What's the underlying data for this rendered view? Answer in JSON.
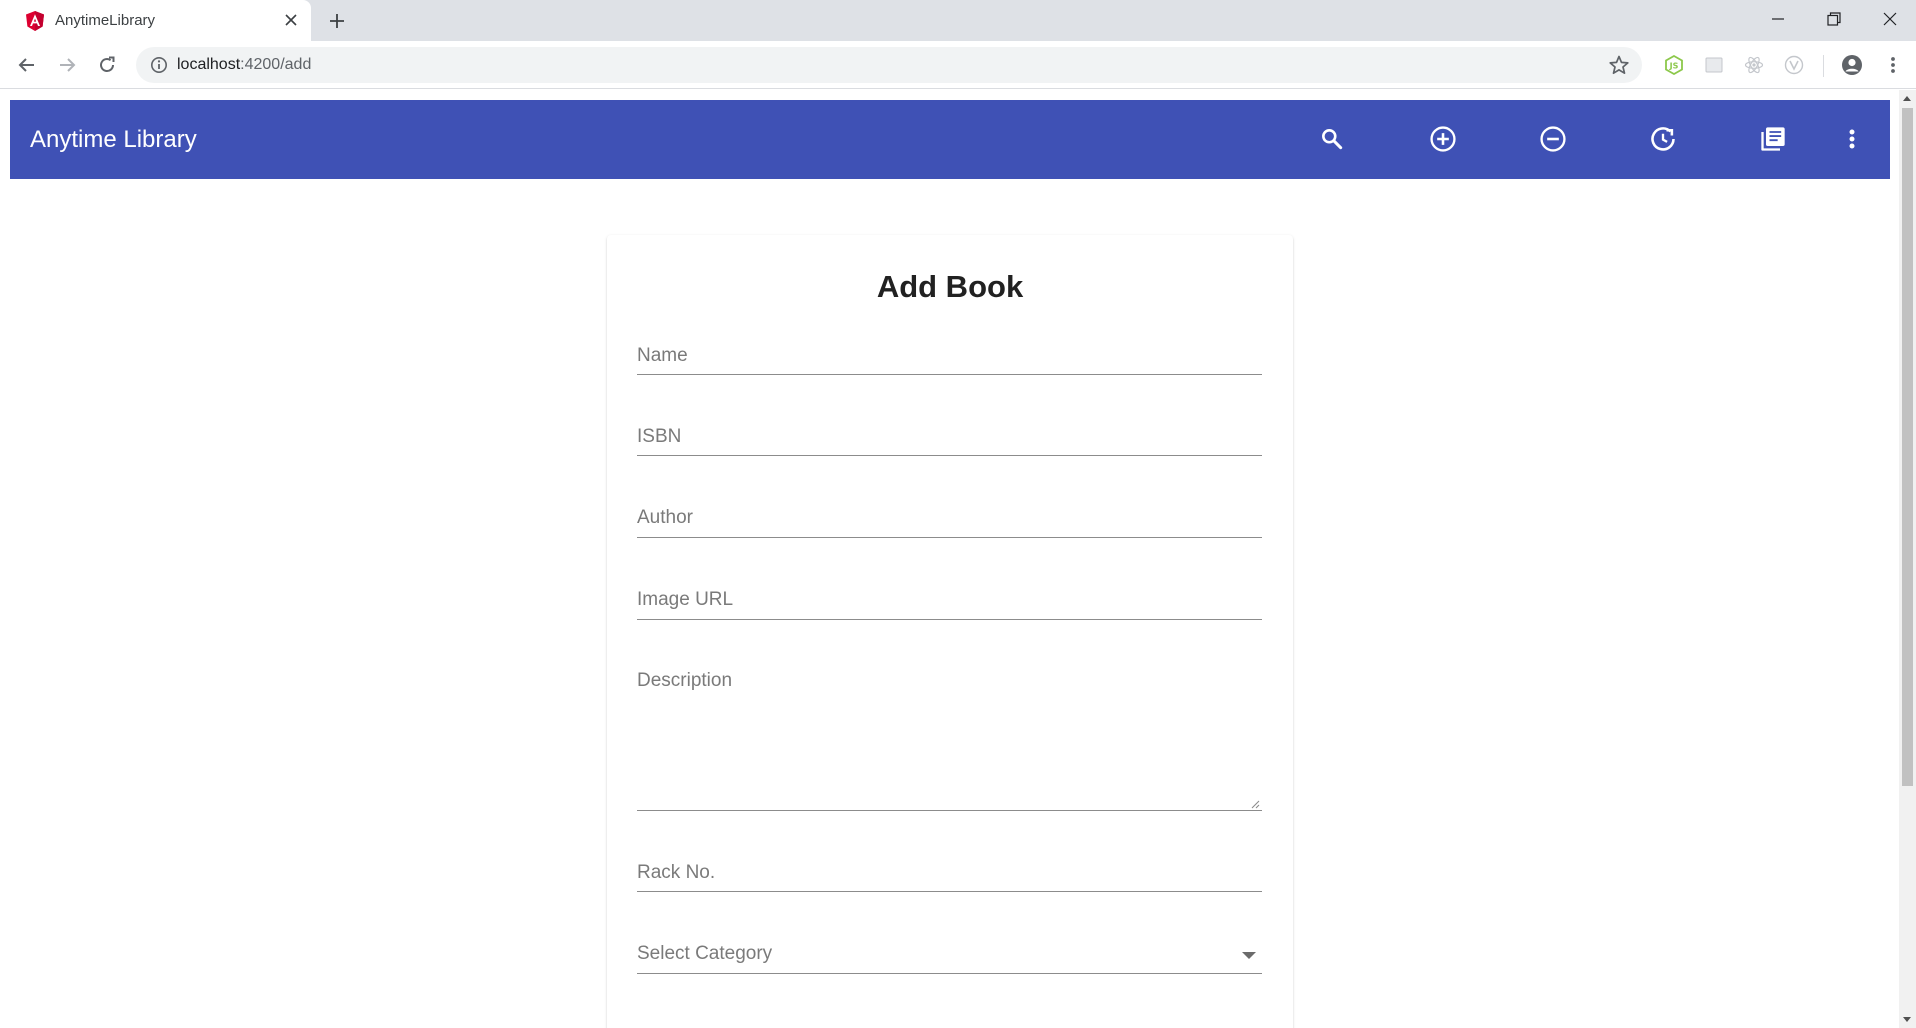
{
  "browser": {
    "tab_title": "AnytimeLibrary",
    "url_host": "localhost",
    "url_path": ":4200/add",
    "favicon": "angular-icon"
  },
  "app": {
    "title": "Anytime Library",
    "toolbar_icons": [
      "search-icon",
      "add-circle-icon",
      "remove-circle-icon",
      "history-icon",
      "library-books-icon",
      "more-vert-icon"
    ],
    "brand_color": "#3f51b5"
  },
  "form": {
    "title": "Add Book",
    "fields": {
      "name": "Name",
      "isbn": "ISBN",
      "author": "Author",
      "image_url": "Image URL",
      "description": "Description",
      "rack_no": "Rack No.",
      "category": "Select Category"
    }
  }
}
